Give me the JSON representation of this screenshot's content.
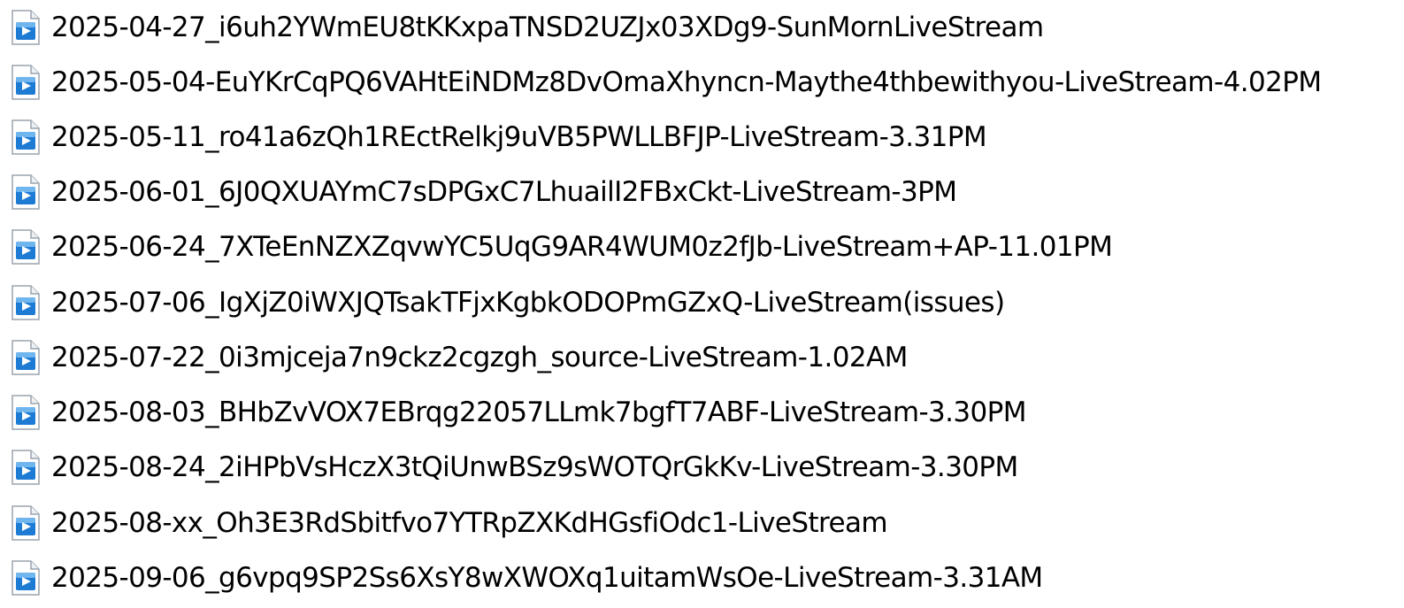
{
  "files": [
    {
      "name": "2025-04-27_i6uh2YWmEU8tKKxpaTNSD2UZJx03XDg9-SunMornLiveStream",
      "icon": "video-file-icon"
    },
    {
      "name": "2025-05-04-EuYKrCqPQ6VAHtEiNDMz8DvOmaXhyncn-Maythe4thbewithyou-LiveStream-4.02PM",
      "icon": "video-file-icon"
    },
    {
      "name": "2025-05-11_ro41a6zQh1REctRelkj9uVB5PWLLBFJP-LiveStream-3.31PM",
      "icon": "video-file-icon"
    },
    {
      "name": "2025-06-01_6J0QXUAYmC7sDPGxC7LhuailI2FBxCkt-LiveStream-3PM",
      "icon": "video-file-icon"
    },
    {
      "name": "2025-06-24_7XTeEnNZXZqvwYC5UqG9AR4WUM0z2fJb-LiveStream+AP-11.01PM",
      "icon": "video-file-icon"
    },
    {
      "name": "2025-07-06_IgXjZ0iWXJQTsakTFjxKgbkODOPmGZxQ-LiveStream(issues)",
      "icon": "video-file-icon"
    },
    {
      "name": "2025-07-22_0i3mjceja7n9ckz2cgzgh_source-LiveStream-1.02AM",
      "icon": "video-file-icon"
    },
    {
      "name": "2025-08-03_BHbZvVOX7EBrqg22057LLmk7bgfT7ABF-LiveStream-3.30PM",
      "icon": "video-file-icon"
    },
    {
      "name": "2025-08-24_2iHPbVsHczX3tQiUnwBSz9sWOTQrGkKv-LiveStream-3.30PM",
      "icon": "video-file-icon"
    },
    {
      "name": "2025-08-xx_Oh3E3RdSbitfvo7YTRpZXKdHGsfiOdc1-LiveStream",
      "icon": "video-file-icon"
    },
    {
      "name": "2025-09-06_g6vpq9SP2Ss6XsY8wXWOXq1uitamWsOe-LiveStream-3.31AM",
      "icon": "video-file-icon"
    }
  ],
  "colors": {
    "icon_page": "#ffffff",
    "icon_border": "#9aa3ad",
    "icon_blue": "#1e7bd4",
    "icon_blue_light": "#6fb5ee",
    "text": "#000000",
    "background": "#ffffff"
  }
}
